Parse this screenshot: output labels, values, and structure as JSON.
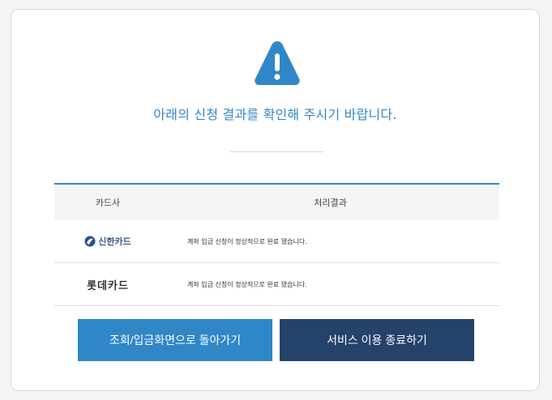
{
  "message": "아래의 신청 결과를 확인해 주시기 바랍니다.",
  "table": {
    "headers": [
      "카드사",
      "처리결과"
    ],
    "rows": [
      {
        "card": "신한카드",
        "result": "계좌 입금 신청이 정상적으로 완료 됐습니다."
      },
      {
        "card": "롯데카드",
        "result": "계좌 입금 신청이 정상적으로 완료 됐습니다."
      }
    ]
  },
  "buttons": {
    "back": "조회/입금화면으로 돌아가기",
    "exit": "서비스 이용 종료하기"
  },
  "icons": [
    "warning-icon",
    "shinhan-logo-icon"
  ],
  "colors": {
    "accent": "#2f87c7",
    "dark_button": "#24426a"
  }
}
